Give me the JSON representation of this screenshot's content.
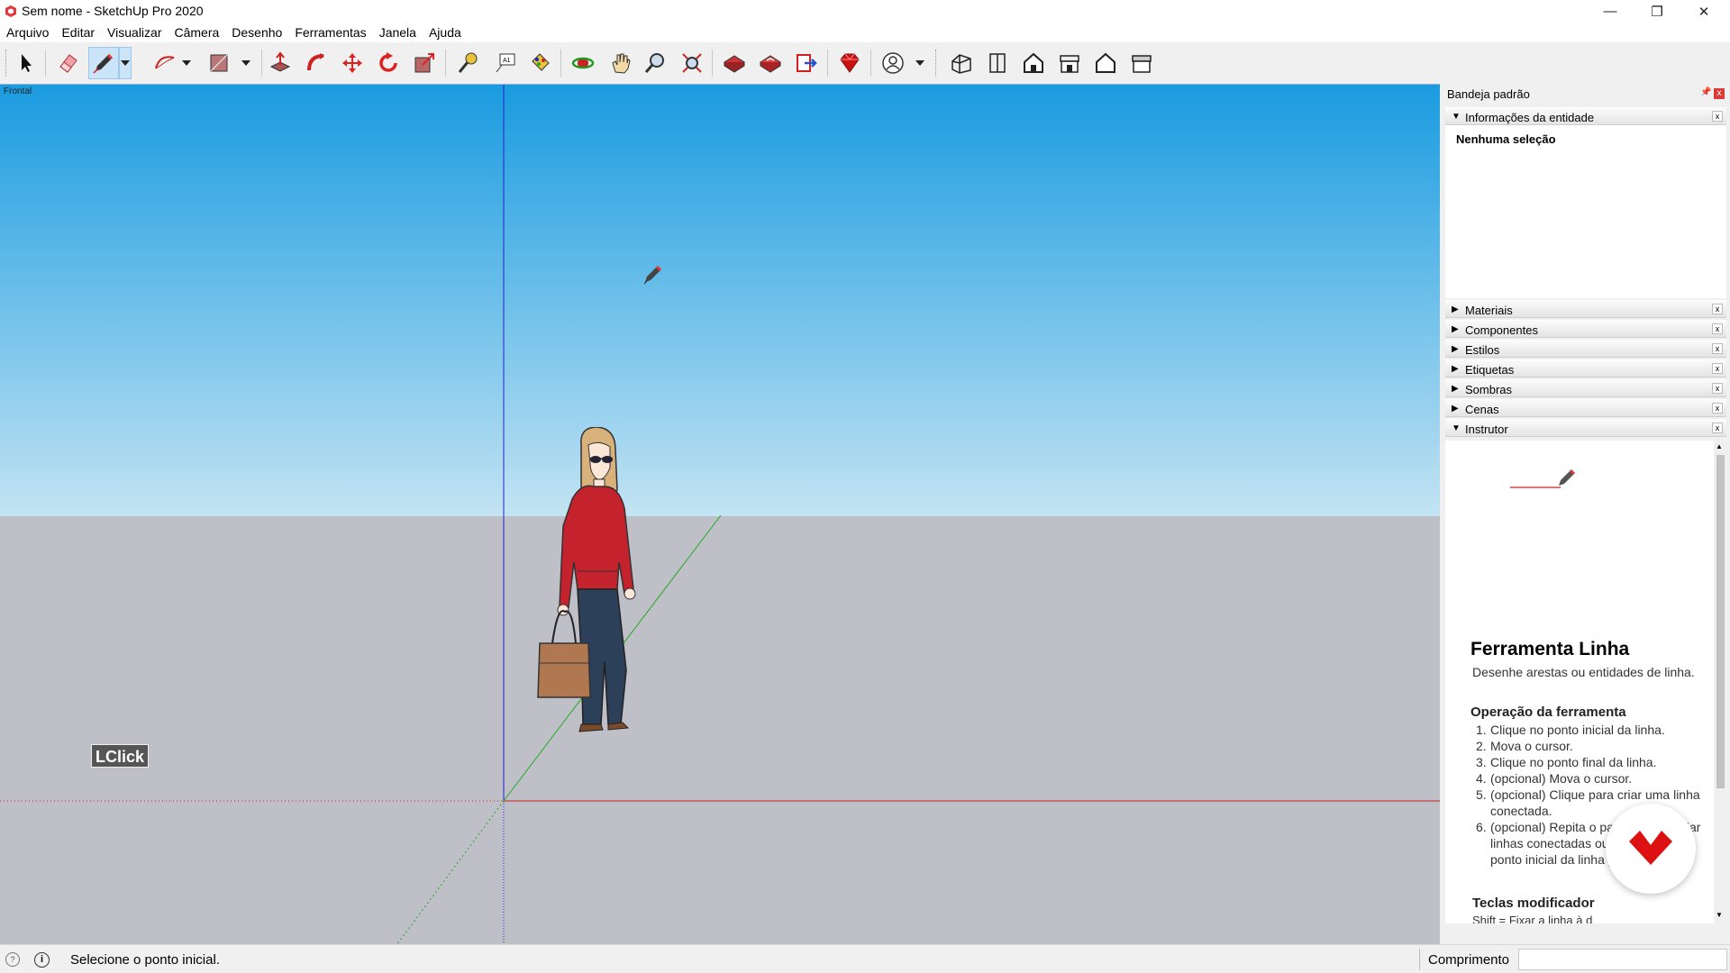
{
  "window": {
    "title": "Sem nome - SketchUp Pro 2020",
    "minimize": "—",
    "restore": "❐",
    "close": "✕"
  },
  "menu": [
    "Arquivo",
    "Editar",
    "Visualizar",
    "Câmera",
    "Desenho",
    "Ferramentas",
    "Janela",
    "Ajuda"
  ],
  "toolbar": {
    "active_tool": "line-tool",
    "tools": [
      "select",
      "eraser",
      "line",
      "arc",
      "rectangle",
      "push-pull",
      "follow-me",
      "move",
      "rotate",
      "scale",
      "tape-measure",
      "text",
      "paint-bucket",
      "orbit",
      "pan",
      "zoom",
      "zoom-extents",
      "3d-warehouse",
      "extension-warehouse",
      "layout",
      "ruby",
      "account",
      "iso",
      "top",
      "front",
      "right",
      "back",
      "left"
    ]
  },
  "viewport": {
    "scene_label": "Frontal",
    "overlay_label": "LClick",
    "colors": {
      "sky_top": "#1a9be0",
      "sky_bottom": "#c3e4f3",
      "ground": "#bfbfc7",
      "red_axis": "#cc2222",
      "green_axis": "#22aa22",
      "blue_axis": "#2222cc"
    }
  },
  "tray": {
    "title": "Bandeja padrão",
    "pin": "📌",
    "close": "x",
    "entity_panel": {
      "label": "Informações da entidade",
      "content": "Nenhuma seleção"
    },
    "panels": [
      {
        "label": "Materiais",
        "expanded": false
      },
      {
        "label": "Componentes",
        "expanded": false
      },
      {
        "label": "Estilos",
        "expanded": false
      },
      {
        "label": "Etiquetas",
        "expanded": false
      },
      {
        "label": "Sombras",
        "expanded": false
      },
      {
        "label": "Cenas",
        "expanded": false
      },
      {
        "label": "Instrutor",
        "expanded": true
      }
    ],
    "instructor": {
      "title": "Ferramenta Linha",
      "description": "Desenhe arestas ou entidades de linha.",
      "operation_heading": "Operação da ferramenta",
      "steps": [
        {
          "n": "1.",
          "text": "Clique no ponto inicial da linha."
        },
        {
          "n": "2.",
          "text": "Mova o cursor."
        },
        {
          "n": "3.",
          "text": "Clique no ponto final da linha."
        },
        {
          "n": "4.",
          "text": "(opcional) Mova o cursor."
        },
        {
          "n": "5.",
          "text": "(opcional) Clique para criar uma linha conectada."
        },
        {
          "n": "6.",
          "text": "(opcional) Repita o passo 4 para criar linhas conectadas ou volte para o ponto inicial da linha para criar uma"
        }
      ],
      "modifier_heading": "Teclas modificador",
      "modifier_line": "Shift = Fixar a linha à d"
    }
  },
  "status": {
    "message": "Selecione o ponto inicial.",
    "measure_label": "Comprimento",
    "measure_value": ""
  }
}
